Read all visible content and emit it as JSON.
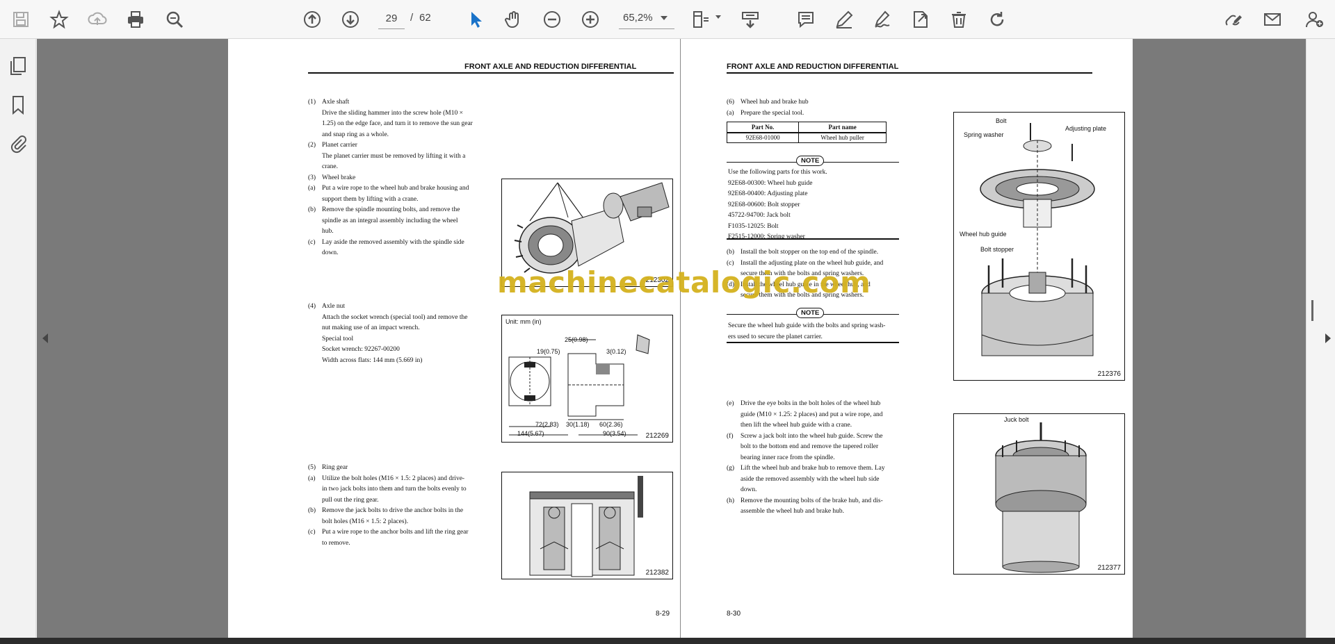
{
  "toolbar": {
    "current_page": "29",
    "page_separator": "/",
    "total_pages": "62",
    "zoom": "65,2%"
  },
  "colors": {
    "toolbar_bg": "#f7f7f7",
    "canvas_bg": "#7a7a7a",
    "select_tool_active": "#1a73c9",
    "watermark": "#d4b21e"
  },
  "icons": [
    "save-icon",
    "star-icon",
    "upload-icon",
    "print-icon",
    "zoom-search-icon",
    "page-up-icon",
    "page-down-icon",
    "select-cursor-icon",
    "hand-icon",
    "zoom-out-icon",
    "zoom-in-icon",
    "fit-page-icon",
    "chevron-down-icon",
    "scroll-mode-icon",
    "comment-icon",
    "highlight-icon",
    "sign-icon",
    "export-icon",
    "delete-icon",
    "rotate-icon",
    "edit-link-icon",
    "email-icon",
    "user-add-icon",
    "pages-panel-icon",
    "bookmark-icon",
    "attachment-icon"
  ],
  "watermark": "machinecatalogic.com",
  "left_page": {
    "header": "FRONT AXLE AND REDUCTION DIFFERENTIAL",
    "page_number": "8-29",
    "block1": [
      {
        "num": "(1)",
        "text": "Axle shaft"
      },
      {
        "num": "",
        "text": "Drive the sliding hammer into the screw hole (M10 ×"
      },
      {
        "num": "",
        "text": "1.25) on the edge face, and turn it to remove the sun gear"
      },
      {
        "num": "",
        "text": "and snap ring as a whole."
      },
      {
        "num": "(2)",
        "text": "Planet carrier"
      },
      {
        "num": "",
        "text": "The planet carrier must be removed by lifting it with a"
      },
      {
        "num": "",
        "text": "crane."
      },
      {
        "num": "(3)",
        "text": "Wheel brake"
      },
      {
        "num": "(a)",
        "text": "Put a wire rope to the wheel hub and brake housing and"
      },
      {
        "num": "",
        "text": "support them by lifting with a crane."
      },
      {
        "num": "(b)",
        "text": "Remove the spindle mounting bolts, and remove the"
      },
      {
        "num": "",
        "text": "spindle as an integral assembly including the wheel"
      },
      {
        "num": "",
        "text": "hub."
      },
      {
        "num": "(c)",
        "text": "Lay aside the removed assembly with the spindle side"
      },
      {
        "num": "",
        "text": "down."
      }
    ],
    "block2": [
      {
        "num": "(4)",
        "text": "Axle nut"
      },
      {
        "num": "",
        "text": "Attach the socket wrench (special tool) and remove the"
      },
      {
        "num": "",
        "text": "nut making use of an impact wrench."
      },
      {
        "num": "",
        "text": "Special tool"
      },
      {
        "num": "",
        "text": "Socket wrench: 92267-00200"
      },
      {
        "num": "",
        "text": "Width across flats: 144 mm (5.669 in)"
      }
    ],
    "block3": [
      {
        "num": "(5)",
        "text": "Ring gear"
      },
      {
        "num": "(a)",
        "text": "Utilize the bolt holes (M16 × 1.5: 2 places) and drive-"
      },
      {
        "num": "",
        "text": "in two jack bolts into them and turn the bolts evenly to"
      },
      {
        "num": "",
        "text": "pull out the ring gear."
      },
      {
        "num": "(b)",
        "text": "Remove the jack bolts to drive the anchor bolts in the"
      },
      {
        "num": "",
        "text": "bolt holes (M16 × 1.5: 2 places)."
      },
      {
        "num": "(c)",
        "text": "Put a wire rope to the anchor bolts and lift the ring gear"
      },
      {
        "num": "",
        "text": "to remove."
      }
    ],
    "fig1": {
      "number": "212302"
    },
    "fig2": {
      "number": "212269",
      "unit": "Unit: mm (in)",
      "dims": [
        "19(0.75)",
        "25(0.98)",
        "3(0.12)",
        "72(2.83)",
        "30(1.18)",
        "60(2.36)",
        "144(5.67)",
        "90(3.54)"
      ]
    },
    "fig3": {
      "number": "212382"
    }
  },
  "right_page": {
    "header": "FRONT AXLE AND REDUCTION DIFFERENTIAL",
    "page_number": "8-30",
    "block1": [
      {
        "num": "(6)",
        "text": "Wheel hub and brake hub"
      },
      {
        "num": "(a)",
        "text": "Prepare the special tool."
      }
    ],
    "table": {
      "headers": [
        "Part No.",
        "Part name"
      ],
      "rows": [
        [
          "92E68-01000",
          "Wheel hub puller"
        ]
      ]
    },
    "note1": {
      "tag": "NOTE",
      "lines": [
        "Use the following parts for this work.",
        "92E68-00300: Wheel hub guide",
        "92E68-00400: Adjusting plate",
        "92E68-00600: Bolt stopper",
        "45722-94700: Jack bolt",
        "F1035-12025: Bolt",
        "F2515-12000: Spring washer"
      ]
    },
    "block2": [
      {
        "num": "(b)",
        "text": "Install the bolt stopper on the top end of the spindle."
      },
      {
        "num": "(c)",
        "text": "Install the adjusting plate on the wheel hub guide, and"
      },
      {
        "num": "",
        "text": "secure them with the bolts and spring washers."
      },
      {
        "num": "(d)",
        "text": "Install the wheel hub guide in the wheel hub, and"
      },
      {
        "num": "",
        "text": "secure them with the bolts and spring washers."
      }
    ],
    "note2": {
      "tag": "NOTE",
      "lines": [
        "Secure the wheel hub guide with the bolts and spring wash-",
        "ers used to secure the planet carrier."
      ]
    },
    "block3": [
      {
        "num": "(e)",
        "text": "Drive the eye bolts in the bolt holes of the wheel hub"
      },
      {
        "num": "",
        "text": "guide (M10 × 1.25: 2 places) and put a wire rope, and"
      },
      {
        "num": "",
        "text": "then lift the wheel hub guide with a crane."
      },
      {
        "num": "(f)",
        "text": "Screw a jack bolt into the wheel hub guide. Screw the"
      },
      {
        "num": "",
        "text": "bolt to the bottom end and remove the tapered roller"
      },
      {
        "num": "",
        "text": "bearing inner race from the spindle."
      },
      {
        "num": "(g)",
        "text": "Lift the wheel hub and brake hub to remove them. Lay"
      },
      {
        "num": "",
        "text": "aside the removed assembly with the wheel hub side"
      },
      {
        "num": "",
        "text": "down."
      },
      {
        "num": "(h)",
        "text": "Remove the mounting bolts of the brake hub, and dis-"
      },
      {
        "num": "",
        "text": "assemble the wheel hub and brake hub."
      }
    ],
    "fig4": {
      "number": "212376",
      "labels": [
        "Bolt",
        "Spring washer",
        "Adjusting plate",
        "Wheel hub guide",
        "Bolt stopper"
      ]
    },
    "fig5": {
      "number": "212377",
      "labels": [
        "Juck bolt"
      ]
    }
  }
}
